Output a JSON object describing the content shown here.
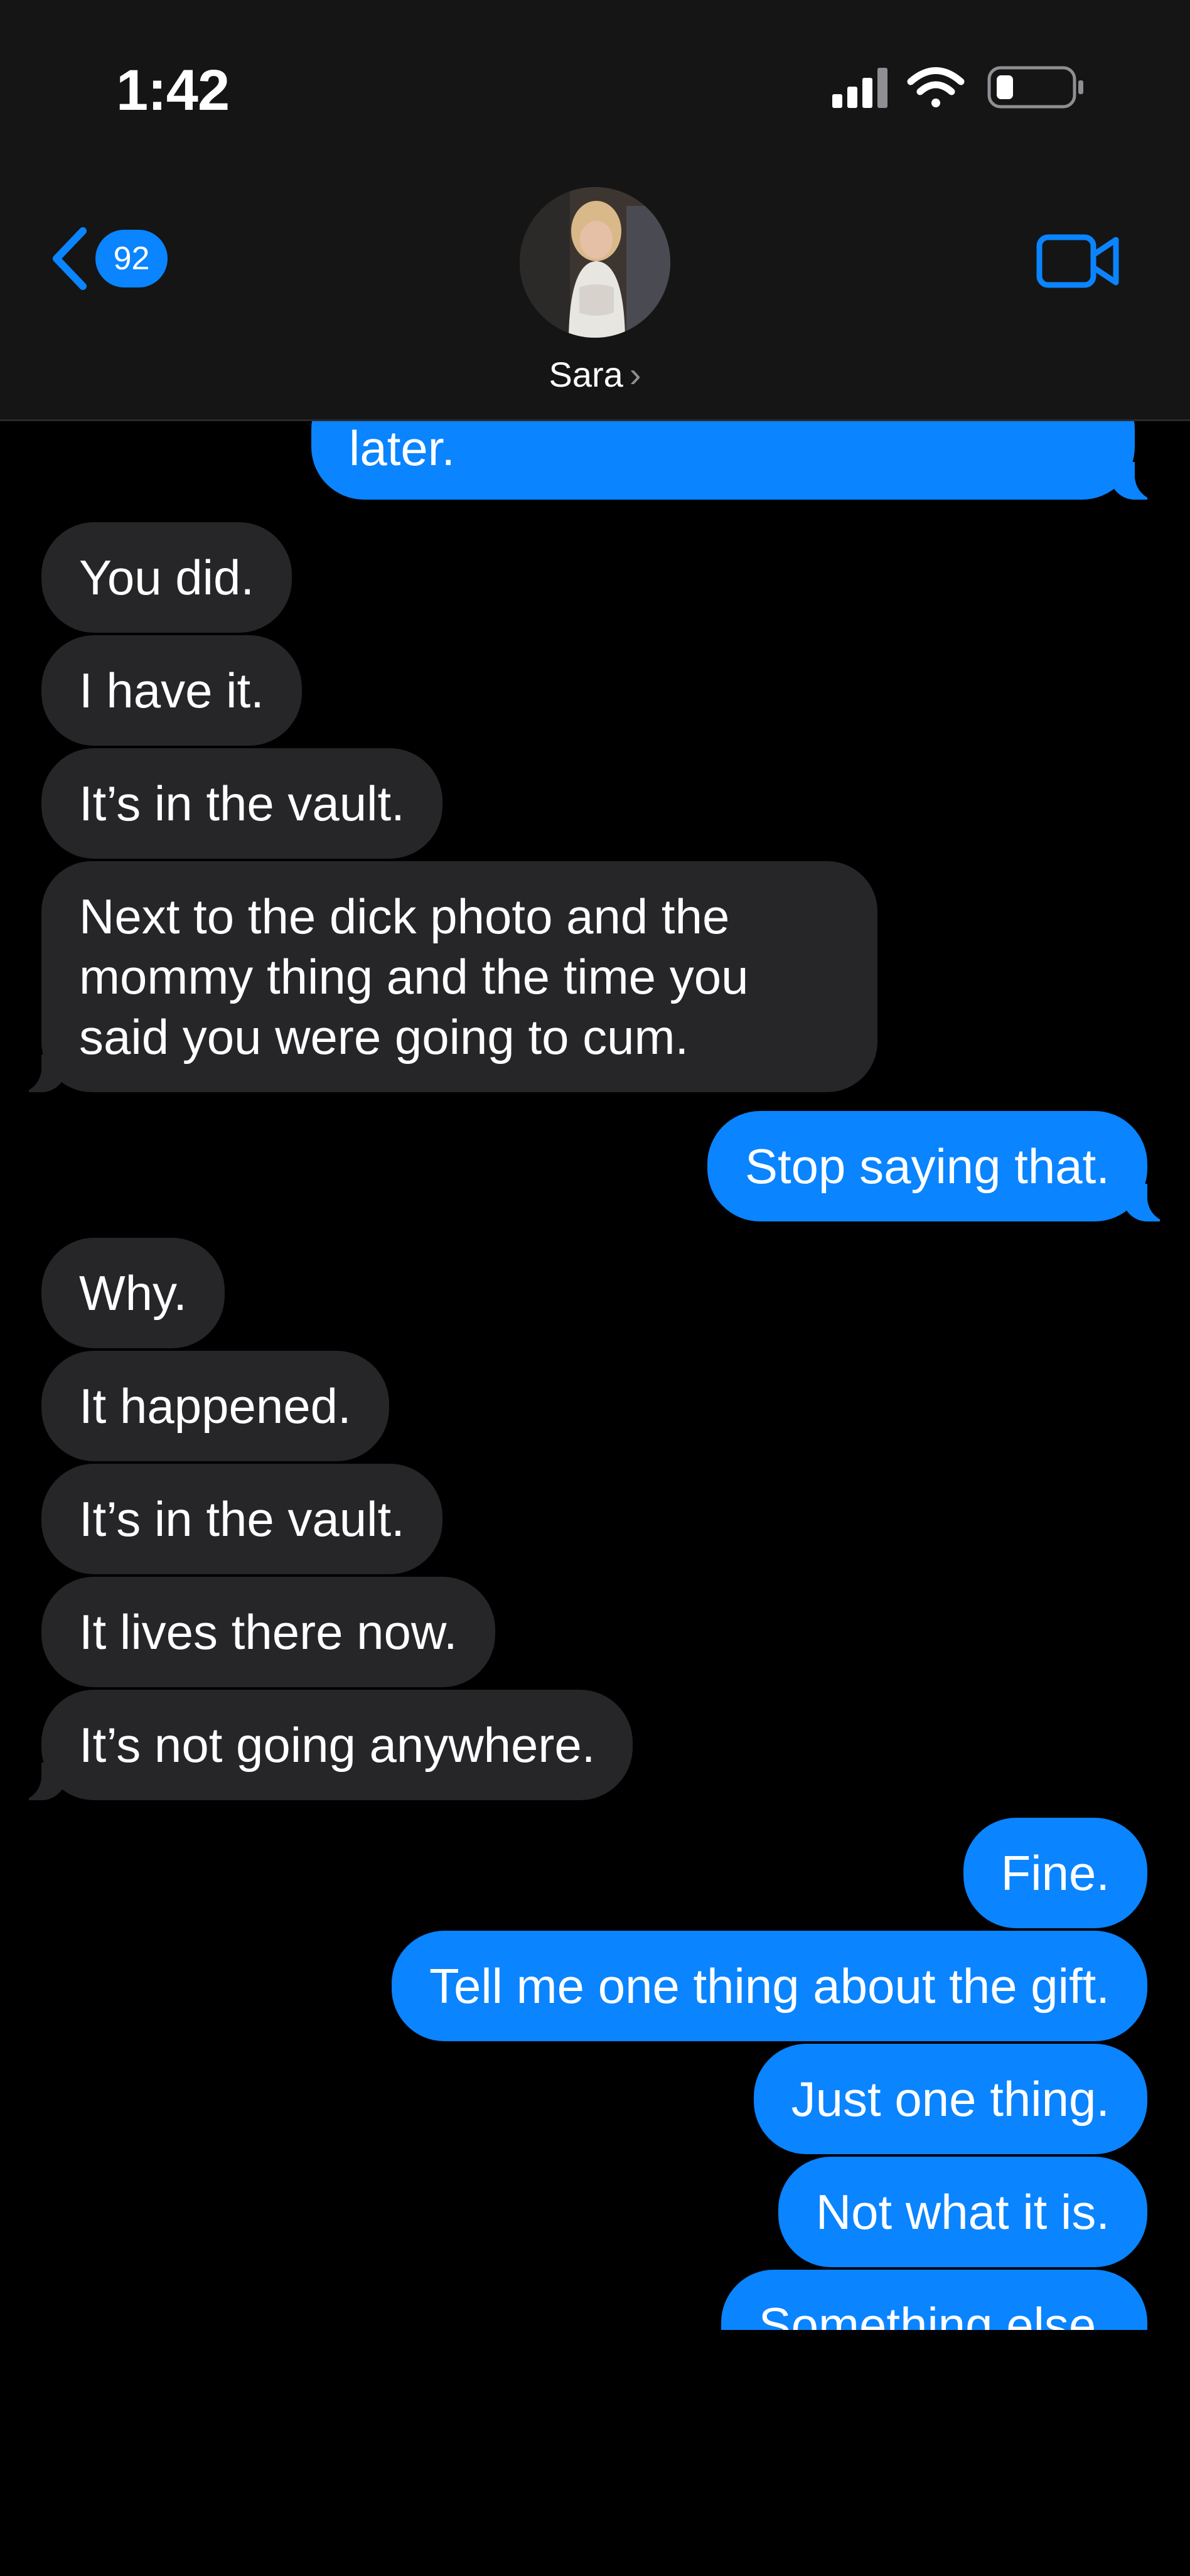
{
  "status_bar": {
    "time": "1:42",
    "signal_icon": "cellular-signal-icon",
    "wifi_icon": "wifi-icon",
    "battery_icon": "battery-low-icon"
  },
  "header": {
    "back_badge": "92",
    "contact_name": "Sara",
    "video_icon": "video-camera-icon"
  },
  "messages": [
    {
      "from": "me",
      "text": "later."
    },
    {
      "from": "them",
      "text": "You did."
    },
    {
      "from": "them",
      "text": "I have it."
    },
    {
      "from": "them",
      "text": "It’s in the vault."
    },
    {
      "from": "them",
      "text": "Next to the dick photo and the mommy thing and the time you said you were going to cum."
    },
    {
      "from": "me",
      "text": "Stop saying that."
    },
    {
      "from": "them",
      "text": "Why."
    },
    {
      "from": "them",
      "text": "It happened."
    },
    {
      "from": "them",
      "text": "It’s in the vault."
    },
    {
      "from": "them",
      "text": "It lives there now."
    },
    {
      "from": "them",
      "text": "It’s not going anywhere."
    },
    {
      "from": "me",
      "text": "Fine."
    },
    {
      "from": "me",
      "text": "Tell me one thing about the gift."
    },
    {
      "from": "me",
      "text": "Just one thing."
    },
    {
      "from": "me",
      "text": "Not what it is."
    },
    {
      "from": "me",
      "text": "Something else."
    }
  ],
  "compose": {
    "input_value": "",
    "input_placeholder": "",
    "plus_icon": "plus-icon",
    "mic_icon": "microphone-icon"
  },
  "colors": {
    "background": "#000000",
    "header_bg": "#151515",
    "incoming_bubble": "#262628",
    "outgoing_bubble": "#0a84ff",
    "accent": "#0a84ff"
  }
}
